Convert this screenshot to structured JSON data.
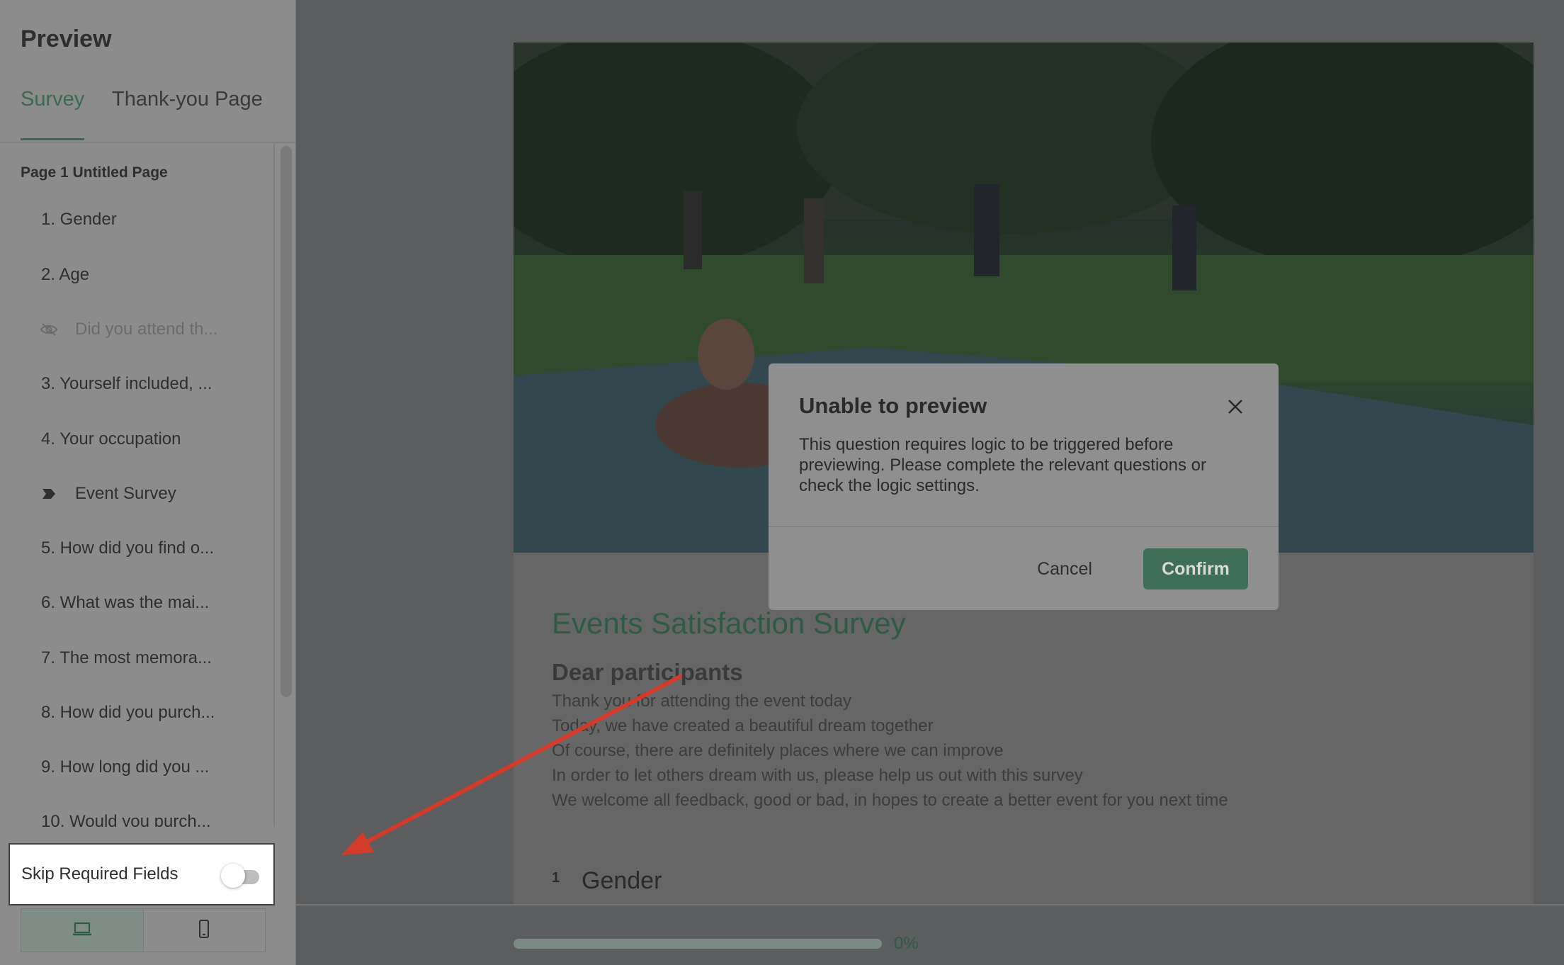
{
  "sidebar": {
    "title": "Preview",
    "tabs": [
      {
        "label": "Survey",
        "active": true
      },
      {
        "label": "Thank-you Page",
        "active": false
      }
    ],
    "page_label": "Page 1 Untitled Page",
    "items": [
      {
        "label": "1. Gender"
      },
      {
        "label": "2. Age"
      },
      {
        "label": "Did you attend th...",
        "icon": "eye-off-icon",
        "hidden": true
      },
      {
        "label": "3. Yourself included, ..."
      },
      {
        "label": "4. Your occupation"
      },
      {
        "label": "Event Survey",
        "icon": "bookmark-icon"
      },
      {
        "label": "5. How did you find o..."
      },
      {
        "label": "6. What was the mai..."
      },
      {
        "label": "7. The most memora..."
      },
      {
        "label": "8. How did you purch..."
      },
      {
        "label": "9. How long did you ..."
      },
      {
        "label": "10. Would you purch..."
      }
    ],
    "skip_required": {
      "label": "Skip Required Fields",
      "enabled": false
    },
    "devices": [
      {
        "icon": "laptop-icon",
        "active": true
      },
      {
        "icon": "mobile-icon",
        "active": false
      }
    ]
  },
  "survey": {
    "title": "Events Satisfaction Survey",
    "greeting": "Dear participants",
    "intro_lines": [
      "Thank you for attending the event today",
      "Today, we have created a beautiful dream together",
      "Of course, there are definitely places where we can improve",
      "In order to let others dream with us, please help us out with this survey",
      "We welcome all feedback, good or bad, in hopes to create a better event for you next time"
    ],
    "first_question": {
      "number": "1",
      "title": "Gender"
    },
    "progress": {
      "label": "0%",
      "value": 0
    }
  },
  "modal": {
    "title": "Unable to preview",
    "body": "This question requires logic to be triggered before previewing. Please complete the relevant questions or check the logic settings.",
    "cancel_label": "Cancel",
    "confirm_label": "Confirm"
  },
  "colors": {
    "accent": "#3f6e57",
    "annotation_arrow": "#d23a2a"
  }
}
